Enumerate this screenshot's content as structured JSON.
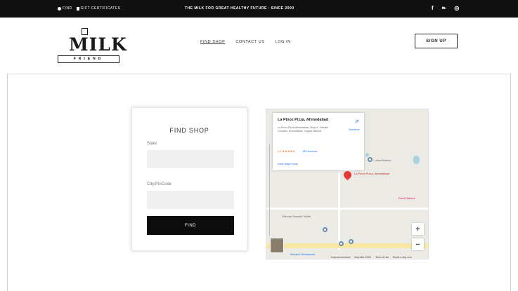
{
  "topbar": {
    "left_items": [
      {
        "icon": "map-pin-icon",
        "label": "FIND"
      },
      {
        "icon": "gift-certificate-icon",
        "label": "GIFT CERTIFICATES"
      }
    ],
    "tagline": "THE MILK FOR GREAT HEALTHY FUTURE · SINCE 2000",
    "social": [
      {
        "icon": "facebook-icon",
        "glyph": "f"
      },
      {
        "icon": "twitter-icon",
        "glyph": "❧"
      },
      {
        "icon": "instagram-icon",
        "glyph": "◎"
      }
    ]
  },
  "header": {
    "logo_text": "MILK",
    "logo_banner": "FRIEND",
    "nav": [
      {
        "label": "FIND SHOP",
        "active": true
      },
      {
        "label": "CONTACT US",
        "active": false
      },
      {
        "label": "LOG IN",
        "active": false
      }
    ],
    "signup_label": "SIGN UP"
  },
  "find_shop": {
    "title": "FIND SHOP",
    "state_label": "State",
    "state_value": "",
    "city_label": "City/PinCode",
    "city_value": "",
    "button_label": "FIND"
  },
  "map": {
    "place_name": "La Pinoz Pizza, Ahmedabad",
    "address": "La Pinoz Pizza Ahmedabad, Shop 8, Shivalik Complex, Ahmedabad, Gujarat 380015",
    "rating_stars": "4.4 ★★★★★",
    "reviews": "183 reviews",
    "larger_map": "View larger map",
    "directions": "Directions",
    "pin_label": "La Pinoz Pizza, Ahmedabad",
    "pois": [
      "Lotus Bakery",
      "Vishvas Swastik Textile",
      "Ruchi Bakers",
      "Mahavir Restaurant"
    ],
    "zoom_in": "+",
    "zoom_out": "−",
    "attribution": [
      "Keyboard shortcuts",
      "Map data ©2020",
      "Terms of Use",
      "Report a map error"
    ]
  }
}
